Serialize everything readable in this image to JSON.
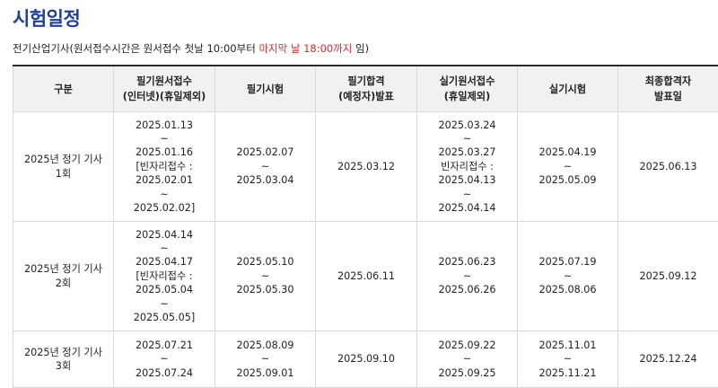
{
  "page": {
    "title": "시험일정",
    "note_prefix": "전기산업기사(원서접수시간은 원서접수 첫날 10:00부터 ",
    "note_highlight": "마지막 날 18:00까지",
    "note_suffix": " 임)"
  },
  "colors": {
    "title": "#1f3fa0",
    "highlight": "#e0262b",
    "header_bg": "#f1f1f1"
  },
  "table": {
    "headers": [
      "구분",
      "필기원서접수\n(인터넷)(휴일제외)",
      "필기시험",
      "필기합격\n(예정자)발표",
      "실기원서접수\n(휴일제외)",
      "실기시험",
      "최종합격자\n발표일"
    ],
    "rows": [
      {
        "category": "2025년 정기 기사\n1회",
        "written_apply": "2025.01.13\n~\n2025.01.16\n[빈자리접수 :\n2025.02.01\n~\n2025.02.02]",
        "written_exam": "2025.02.07\n~\n2025.03.04",
        "written_result": "2025.03.12",
        "practical_apply": "2025.03.24\n~\n2025.03.27\n빈자리접수 :\n2025.04.13\n~\n2025.04.14",
        "practical_exam": "2025.04.19\n~\n2025.05.09",
        "final_result": "2025.06.13"
      },
      {
        "category": "2025년 정기 기사\n2회",
        "written_apply": "2025.04.14\n~\n2025.04.17\n[빈자리접수 :\n2025.05.04\n~\n2025.05.05]",
        "written_exam": "2025.05.10\n~\n2025.05.30",
        "written_result": "2025.06.11",
        "practical_apply": "2025.06.23\n~\n2025.06.26",
        "practical_exam": "2025.07.19\n~\n2025.08.06",
        "final_result": "2025.09.12"
      },
      {
        "category": "2025년 정기 기사\n3회",
        "written_apply": "2025.07.21\n~\n2025.07.24",
        "written_exam": "2025.08.09\n~\n2025.09.01",
        "written_result": "2025.09.10",
        "practical_apply": "2025.09.22\n~\n2025.09.25",
        "practical_exam": "2025.11.01\n~\n2025.11.21",
        "final_result": "2025.12.24"
      }
    ]
  }
}
